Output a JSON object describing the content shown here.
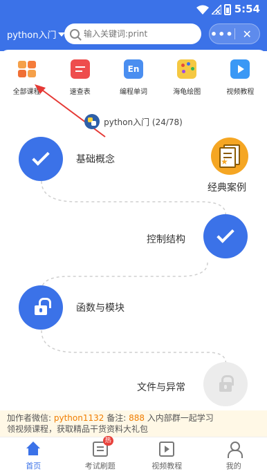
{
  "status_bar": {
    "time": "5:54"
  },
  "header": {
    "language_selector": "python入门",
    "search_placeholder": "输入关键词:print",
    "more_icon": "ellipsis-icon",
    "close_icon": "close-icon"
  },
  "menu": {
    "items": [
      {
        "label": "全部课程",
        "icon": "grid-icon"
      },
      {
        "label": "速查表",
        "icon": "cheatsheet-icon"
      },
      {
        "label": "编程单词",
        "icon": "en-dictionary-icon"
      },
      {
        "label": "海龟绘图",
        "icon": "palette-icon"
      },
      {
        "label": "视频教程",
        "icon": "play-icon"
      }
    ]
  },
  "course": {
    "title": "python入门 (24/78)",
    "nodes": [
      {
        "label": "基础概念",
        "state": "done"
      },
      {
        "label": "经典案例",
        "state": "special"
      },
      {
        "label": "控制结构",
        "state": "done"
      },
      {
        "label": "函数与模块",
        "state": "unlocked"
      },
      {
        "label": "文件与异常",
        "state": "locked"
      }
    ]
  },
  "promo": {
    "line1_prefix": "加作者微信: ",
    "wechat": "python1132",
    "line1_mid": " 备注: ",
    "code": "888",
    "line1_suffix": " 入内部群一起学习",
    "line2": "领视频课程，获取精品干货资料大礼包"
  },
  "bottom_nav": {
    "items": [
      {
        "label": "首页",
        "icon": "home-icon",
        "active": true
      },
      {
        "label": "考试刷题",
        "icon": "exam-icon",
        "badge": "热"
      },
      {
        "label": "视频教程",
        "icon": "video-icon"
      },
      {
        "label": "我的",
        "icon": "profile-icon"
      }
    ]
  },
  "colors": {
    "primary": "#3b72e8",
    "accent_orange": "#f5a623",
    "highlight": "#f07d00",
    "annotation_arrow": "#e53935"
  }
}
